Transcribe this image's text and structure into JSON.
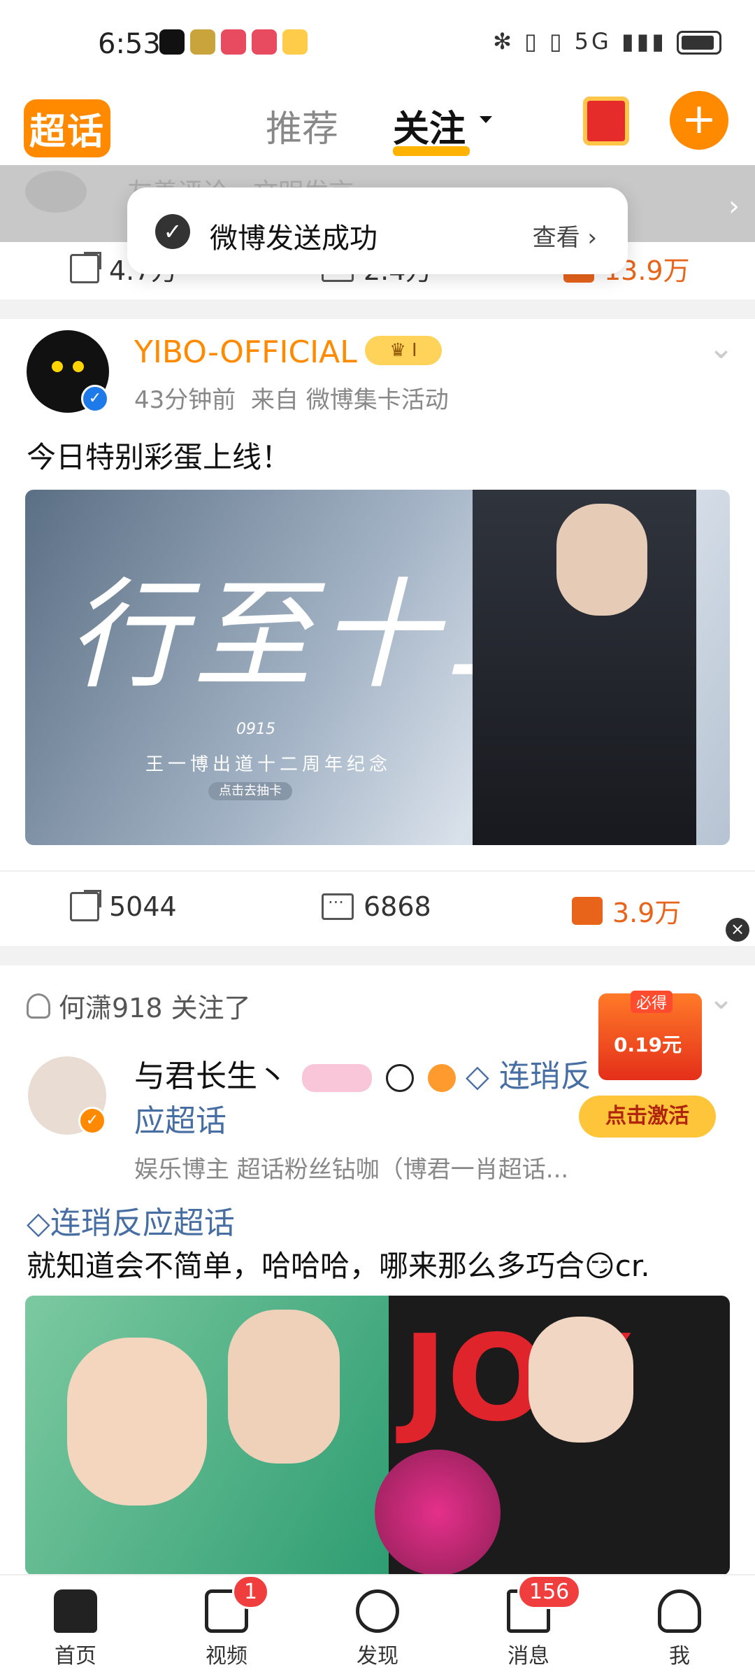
{
  "status_bar": {
    "time": "6:53",
    "right_icons": "✻ ▯ ▯ 5G ▮▮▮"
  },
  "header": {
    "logo": "超话",
    "tab_recommend": "推荐",
    "tab_follow": "关注"
  },
  "prev_post": {
    "placeholder": "友善评论，文明发言",
    "share": "4.7万",
    "comment": "2.4万",
    "like": "13.9万"
  },
  "toast": {
    "message": "微博发送成功",
    "action": "查看"
  },
  "post1": {
    "username": "YIBO-OFFICIAL",
    "level": "I",
    "time": "43分钟前",
    "source": "来自 微博集卡活动",
    "text": "今日特别彩蛋上线！",
    "image_title": "行至十二",
    "image_code": "0915",
    "image_sub": "王一博出道十二周年纪念",
    "image_tap": "点击去抽卡",
    "share": "5044",
    "comment": "6868",
    "like": "3.9万"
  },
  "post2": {
    "follow_note": "何潇918 关注了",
    "username": "与君长生丶",
    "topic_tag_a": "连琑反",
    "topic_tag_b": "应超话",
    "meta": "娱乐博主 超话粉丝钻咖（博君一肖超话...",
    "topic": "连琑反应超话",
    "text": "就知道会不简单，哈哈哈，哪来那么多巧合😏cr.",
    "image_word": "JOY",
    "ad_must": "必得",
    "ad_amount": "0.19元",
    "ad_button": "点击激活"
  },
  "nav": {
    "home": "首页",
    "video": "视频",
    "video_badge": "1",
    "discover": "发现",
    "messages": "消息",
    "messages_badge": "156",
    "me": "我"
  }
}
